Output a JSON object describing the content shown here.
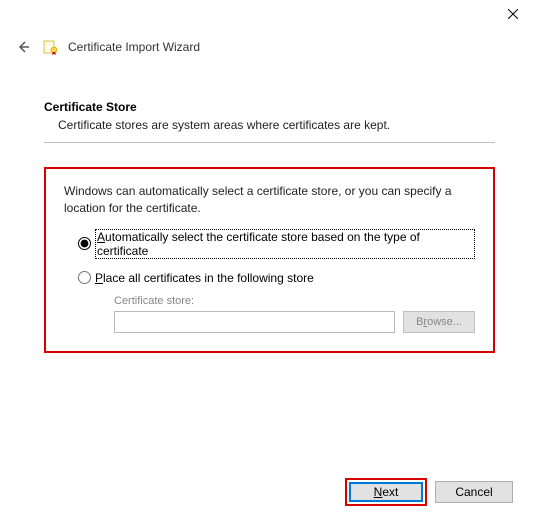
{
  "window": {
    "title": "Certificate Import Wizard"
  },
  "section": {
    "heading": "Certificate Store",
    "description": "Certificate stores are system areas where certificates are kept."
  },
  "body": {
    "instruction": "Windows can automatically select a certificate store, or you can specify a location for the certificate.",
    "option_auto": "Automatically select the certificate store based on the type of certificate",
    "option_manual": "Place all certificates in the following store",
    "store_label": "Certificate store:",
    "store_value": "",
    "browse_label": "Browse..."
  },
  "footer": {
    "next_label": "Next",
    "cancel_label": "Cancel"
  },
  "state": {
    "selected_option": "auto",
    "browse_enabled": false,
    "store_input_enabled": false
  }
}
